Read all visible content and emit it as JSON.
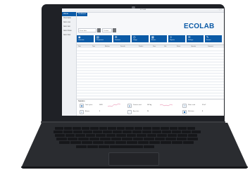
{
  "window": {
    "title": "ECOLAB",
    "controls": "–  ◻  ✕"
  },
  "sidebar": {
    "items": [
      {
        "label": "Home"
      },
      {
        "label": "Overview"
      },
      {
        "label": "Item one"
      },
      {
        "label": "Item two"
      },
      {
        "label": "Item three"
      },
      {
        "label": "Item four"
      }
    ]
  },
  "tabs": [
    {
      "label": "Dashboard"
    }
  ],
  "brand": {
    "logo_text": "ECOLAB",
    "color": "#0b5aa6"
  },
  "filters": {
    "from_label": "From date",
    "to_label": "To date"
  },
  "tiles": [
    {
      "icon": "◉",
      "label": "Overview"
    },
    {
      "icon": "▤",
      "label": "Dispensers"
    },
    {
      "icon": "⚙",
      "label": "Products"
    },
    {
      "icon": "◷",
      "label": "Usage"
    },
    {
      "icon": "▦",
      "label": "Alarms"
    },
    {
      "icon": "⇩",
      "label": "Reports"
    },
    {
      "icon": "☰",
      "label": "Settings"
    },
    {
      "icon": "✎",
      "label": "Service"
    }
  ],
  "grid": {
    "title": "Product usage",
    "columns": [
      "Date",
      "Time",
      "Machine",
      "Formula",
      "Product",
      "Dose",
      "Unit",
      "Status",
      "Operator",
      "Comment"
    ]
  },
  "summary": {
    "title": "Statistics",
    "stats": [
      {
        "icon": "▣",
        "label": "Total cycles",
        "value": "1023"
      },
      {
        "icon": "◈",
        "label": "Product used",
        "value": "102 kg"
      },
      {
        "icon": "⬡",
        "label": "Water used",
        "value": "12 m³"
      },
      {
        "icon": "⚠",
        "label": "Alarms",
        "value": "3"
      },
      {
        "icon": "◔",
        "label": "Avg. time",
        "value": "24"
      },
      {
        "icon": "⬢",
        "label": "Machines",
        "value": "8"
      }
    ]
  }
}
